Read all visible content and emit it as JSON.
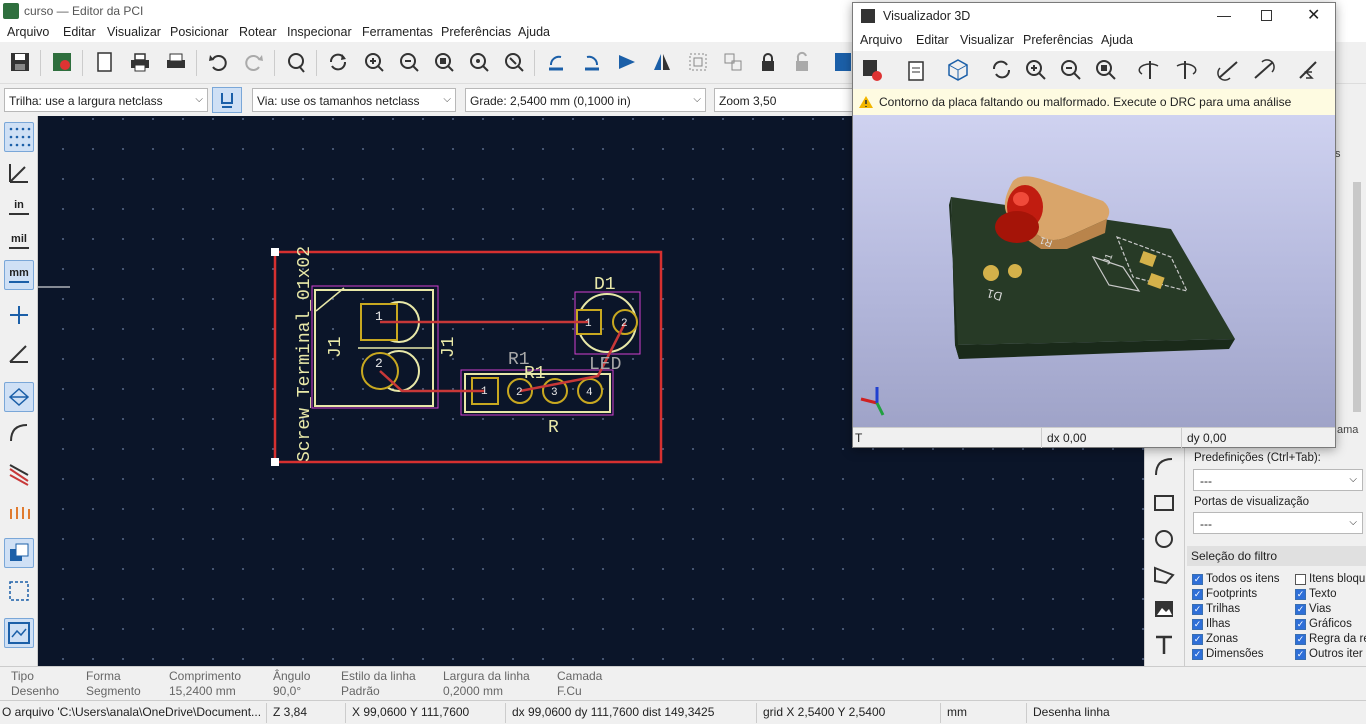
{
  "window": {
    "title": "curso — Editor da PCI"
  },
  "menu": [
    "Arquivo",
    "Editar",
    "Visualizar",
    "Posicionar",
    "Rotear",
    "Inspecionar",
    "Ferramentas",
    "Preferências",
    "Ajuda"
  ],
  "selectors": {
    "track": "Trilha: use a largura netclass",
    "via": "Via: use os tamanhos netclass",
    "grid": "Grade: 2,5400 mm (0,1000 in)",
    "zoom": "Zoom 3,50"
  },
  "left_toolbar": {
    "units_in": "in",
    "units_mil": "mil",
    "units_mm": "mm"
  },
  "pcb": {
    "j1_value": "Screw_Terminal_01x02",
    "j1_ref": "J1",
    "j1_ref2": "J1",
    "d1_ref": "D1",
    "d1_value": "LED",
    "r1_ref": "R1",
    "r1_ref2": "R1",
    "r1_value": "R",
    "pad1": "1",
    "pad2": "2",
    "pad3": "3",
    "pad4": "4"
  },
  "viewer3d": {
    "title": "Visualizador 3D",
    "menu": [
      "Arquivo",
      "Editar",
      "Visualizar",
      "Preferências",
      "Ajuda"
    ],
    "warning": "Contorno da placa faltando ou malformado. Execute o DRC para uma análise",
    "status_left": "T",
    "status_dx": "dx 0,00",
    "status_dy": "dy 0,00",
    "silk_r1": "R1",
    "silk_d1": "D1",
    "silk_j1": "J1"
  },
  "right_panel": {
    "tab_stub": "s",
    "side_stub": "ama",
    "presets_label": "Predefinições (Ctrl+Tab):",
    "presets_value": "---",
    "viewports_label": "Portas de visualização",
    "viewports_value": "---",
    "filter_header": "Seleção do filtro",
    "filters": [
      {
        "label": "Todos os itens",
        "checked": true
      },
      {
        "label": "Itens bloqu",
        "checked": false
      },
      {
        "label": "Footprints",
        "checked": true
      },
      {
        "label": "Texto",
        "checked": true
      },
      {
        "label": "Trilhas",
        "checked": true
      },
      {
        "label": "Vias",
        "checked": true
      },
      {
        "label": "Ilhas",
        "checked": true
      },
      {
        "label": "Gráficos",
        "checked": true
      },
      {
        "label": "Zonas",
        "checked": true
      },
      {
        "label": "Regra da re",
        "checked": true
      },
      {
        "label": "Dimensões",
        "checked": true
      },
      {
        "label": "Outros iter",
        "checked": true
      }
    ]
  },
  "message_panel": [
    {
      "label": "Tipo",
      "value": "Desenho"
    },
    {
      "label": "Forma",
      "value": "Segmento"
    },
    {
      "label": "Comprimento",
      "value": "15,2400 mm"
    },
    {
      "label": "Ângulo",
      "value": "90,0°"
    },
    {
      "label": "Estilo da linha",
      "value": "Padrão"
    },
    {
      "label": "Largura da linha",
      "value": "0,2000 mm"
    },
    {
      "label": "Camada",
      "value": "F.Cu"
    }
  ],
  "status": {
    "file": "O arquivo 'C:\\Users\\anala\\OneDrive\\Document...",
    "zoom": "Z 3,84",
    "xy": "X 99,0600  Y 111,7600",
    "dxy": "dx 99,0600  dy 111,7600  dist 149,3425",
    "grid": "grid X 2,5400  Y 2,5400",
    "units": "mm",
    "tool": "Desenha linha"
  },
  "colors": {
    "canvas_bg": "#0b1529",
    "edge_cuts": "#d63030",
    "silkscreen": "#e8e8a8",
    "courtyard": "#d040d0",
    "copper_track": "#c83838",
    "pad": "#c8a820"
  }
}
